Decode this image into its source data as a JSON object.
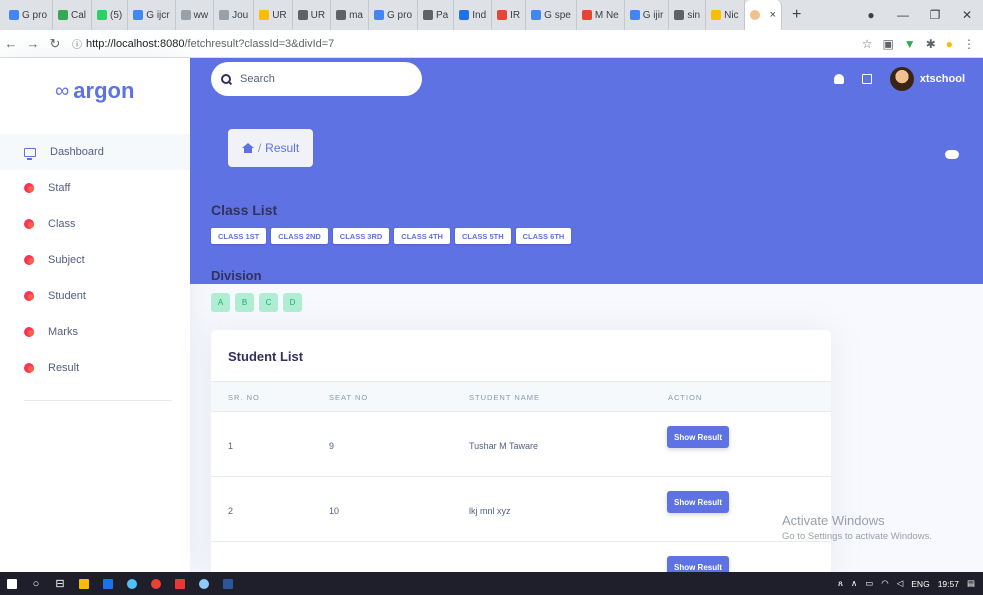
{
  "browser": {
    "tabs": [
      {
        "label": "G pro",
        "color": "#4285f4"
      },
      {
        "label": "Cal",
        "color": "#34a853"
      },
      {
        "label": "(5)",
        "color": "#25d366"
      },
      {
        "label": "G ijcr",
        "color": "#4285f4"
      },
      {
        "label": "ww",
        "color": "#9aa0a6"
      },
      {
        "label": "Jou",
        "color": "#9aa0a6"
      },
      {
        "label": "UR",
        "color": "#fbbc05"
      },
      {
        "label": "UR",
        "color": "#5f6368"
      },
      {
        "label": "ma",
        "color": "#5f6368"
      },
      {
        "label": "G pro",
        "color": "#4285f4"
      },
      {
        "label": "Pa",
        "color": "#5f6368"
      },
      {
        "label": "Ind",
        "color": "#1a73e8"
      },
      {
        "label": "IR",
        "color": "#ea4335"
      },
      {
        "label": "G spe",
        "color": "#4285f4"
      },
      {
        "label": "M Ne",
        "color": "#ea4335"
      },
      {
        "label": "G ijir",
        "color": "#4285f4"
      },
      {
        "label": "sin",
        "color": "#5f6368"
      },
      {
        "label": "Nic",
        "color": "#fbbc05"
      }
    ],
    "active_tab": {
      "label": "",
      "close": "×"
    },
    "new_tab": "+",
    "url": {
      "host": "http://localhost:8080",
      "path": "/fetchresult?classId=3&divId=7"
    }
  },
  "sidebar": {
    "brand": "argon",
    "items": [
      {
        "label": "Dashboard",
        "icon": "monitor-icon"
      },
      {
        "label": "Staff",
        "icon": "planet-icon"
      },
      {
        "label": "Class",
        "icon": "planet-icon"
      },
      {
        "label": "Subject",
        "icon": "planet-icon"
      },
      {
        "label": "Student",
        "icon": "planet-icon"
      },
      {
        "label": "Marks",
        "icon": "planet-icon"
      },
      {
        "label": "Result",
        "icon": "planet-icon"
      }
    ]
  },
  "header": {
    "search_placeholder": "Search",
    "username": "xtschool",
    "breadcrumb": "Result",
    "breadcrumb_sep": "/"
  },
  "classes": {
    "title": "Class List",
    "items": [
      "CLASS 1ST",
      "CLASS 2ND",
      "CLASS 3RD",
      "CLASS 4TH",
      "CLASS 5TH",
      "CLASS 6TH"
    ]
  },
  "divisions": {
    "title": "Division",
    "items": [
      "A",
      "B",
      "C",
      "D"
    ]
  },
  "student_list": {
    "title": "Student List",
    "columns": [
      "SR. NO",
      "SEAT NO",
      "STUDENT NAME",
      "ACTION"
    ],
    "action_label": "Show Result",
    "rows": [
      {
        "sr": "1",
        "seat": "9",
        "name": "Tushar M Taware"
      },
      {
        "sr": "2",
        "seat": "10",
        "name": "lkj mnl xyz"
      },
      {
        "sr": "",
        "seat": "",
        "name": ""
      }
    ]
  },
  "watermark": {
    "line1": "Activate Windows",
    "line2": "Go to Settings to activate Windows."
  },
  "taskbar": {
    "lang": "ENG",
    "time": "19:57"
  },
  "colors": {
    "primary": "#5e72e4",
    "success_light": "#b0eed3",
    "success": "#1aae6f"
  }
}
